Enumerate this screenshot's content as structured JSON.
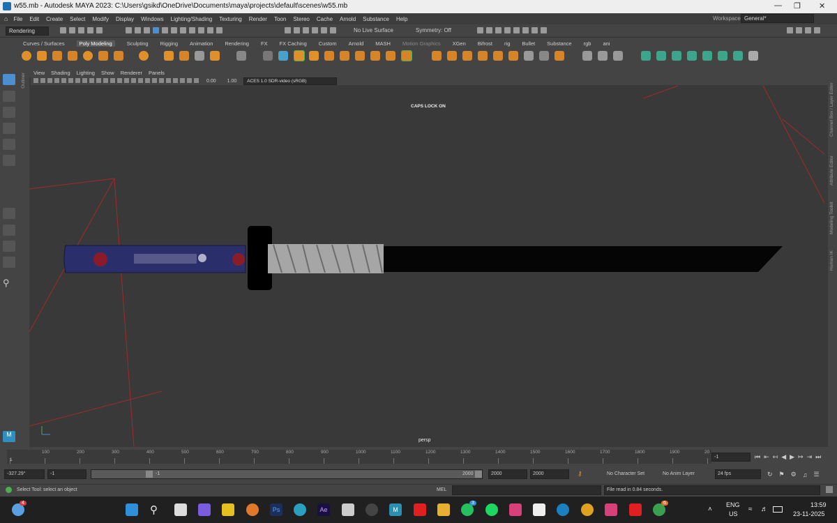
{
  "window": {
    "title": "w55.mb - Autodesk MAYA 2023: C:\\Users\\gsikd\\OneDrive\\Documents\\maya\\projects\\default\\scenes\\w55.mb"
  },
  "menu": [
    "File",
    "Edit",
    "Create",
    "Select",
    "Modify",
    "Display",
    "Windows",
    "Lighting/Shading",
    "Texturing",
    "Render",
    "Toon",
    "Stereo",
    "Cache",
    "Arnold",
    "Substance",
    "Help"
  ],
  "workspace": {
    "label": "Workspace:",
    "value": "General*"
  },
  "statusline": {
    "menuset": "Rendering",
    "live_surface": "No Live Surface",
    "symmetry": "Symmetry: Off"
  },
  "shelf_tabs": [
    "Curves / Surfaces",
    "Poly Modeling",
    "Sculpting",
    "Rigging",
    "Animation",
    "Rendering",
    "FX",
    "FX Caching",
    "Custom",
    "Arnold",
    "MASH",
    "Motion Graphics",
    "XGen",
    "Bifrost",
    "rig",
    "Bullet",
    "Substance",
    "rgb",
    "ani"
  ],
  "shelf_active": "Poly Modeling",
  "viewport": {
    "menu": [
      "View",
      "Shading",
      "Lighting",
      "Show",
      "Renderer",
      "Panels"
    ],
    "exposure": "0.00",
    "gamma": "1.00",
    "colorspace": "ACES 1.0 SDR-video (sRGB)",
    "caps_notice": "CAPS LOCK ON",
    "camera": "persp",
    "side_tabs": [
      "Outliner"
    ],
    "right_tabs": [
      "Channel Box / Layer Editor",
      "Attribute Editor",
      "Modeling Toolkit",
      "Human IK"
    ]
  },
  "timeline": {
    "labels": [
      "1",
      "100",
      "200",
      "300",
      "400",
      "500",
      "600",
      "700",
      "800",
      "900",
      "1000",
      "1100",
      "1200",
      "1300",
      "1400",
      "1500",
      "1600",
      "1700",
      "1800",
      "1900",
      "20"
    ],
    "current_frame": "-1",
    "current_frame_display": "1"
  },
  "range": {
    "value_left": "-327.29°",
    "start": "-1",
    "slider_start": "-1",
    "slider_end": "2000",
    "end_a": "2000",
    "end_b": "2000",
    "character_set": "No Character Set",
    "anim_layer": "No Anim Layer",
    "fps": "24 fps"
  },
  "helpline": {
    "text": "Select Tool: select an object",
    "mel_label": "MEL",
    "result": "File read in  0.84 seconds."
  },
  "taskbar": {
    "lang1": "ENG",
    "lang2": "US",
    "time": "13:59",
    "date": "23-11-2025",
    "badge_chat": "3",
    "badge_chrome": "6",
    "badge_weather": "4"
  }
}
